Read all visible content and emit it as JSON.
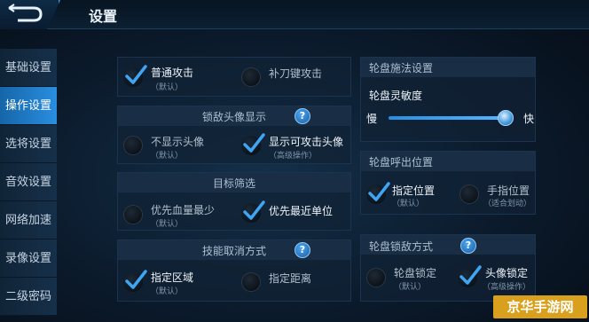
{
  "header": {
    "title": "设置"
  },
  "sidebar": {
    "items": [
      {
        "label": "基础设置"
      },
      {
        "label": "操作设置"
      },
      {
        "label": "选将设置"
      },
      {
        "label": "音效设置"
      },
      {
        "label": "网络加速"
      },
      {
        "label": "录像设置"
      },
      {
        "label": "二级密码"
      }
    ],
    "active_index": 1
  },
  "left": {
    "attack": {
      "option1": {
        "label": "普通攻击",
        "sub": "（默认）",
        "checked": true
      },
      "option2": {
        "label": "补刀键攻击",
        "checked": false
      }
    },
    "lock_avatar": {
      "title": "锁敌头像显示",
      "option1": {
        "label": "不显示头像",
        "sub": "（默认）",
        "checked": false
      },
      "option2": {
        "label": "显示可攻击头像",
        "sub": "（高级操作）",
        "checked": true
      }
    },
    "target_filter": {
      "title": "目标筛选",
      "option1": {
        "label": "优先血量最少",
        "sub": "（默认）",
        "checked": false
      },
      "option2": {
        "label": "优先最近单位",
        "checked": true
      }
    },
    "skill_cancel": {
      "title": "技能取消方式",
      "option1": {
        "label": "指定区域",
        "sub": "（默认）",
        "checked": true
      },
      "option2": {
        "label": "指定距离",
        "checked": false
      }
    }
  },
  "right": {
    "wheel_cast": {
      "title": "轮盘施法设置",
      "sensitivity_label": "轮盘灵敏度",
      "slow_label": "慢",
      "fast_label": "快",
      "sensitivity_level": 0.96
    },
    "wheel_call": {
      "title": "轮盘呼出位置",
      "option1": {
        "label": "指定位置",
        "sub": "（默认）",
        "checked": true
      },
      "option2": {
        "label": "手指位置",
        "sub": "（适合划动）",
        "checked": false
      }
    },
    "wheel_lock": {
      "title": "轮盘锁敌方式",
      "option1": {
        "label": "轮盘锁定",
        "sub": "（默认）",
        "checked": false
      },
      "option2": {
        "label": "头像锁定",
        "sub": "（高级操作）",
        "checked": true
      }
    }
  },
  "help_label": "?",
  "watermark": "京华手游网",
  "colors": {
    "accent": "#2a8ee0",
    "check": "#3fa4f2"
  }
}
